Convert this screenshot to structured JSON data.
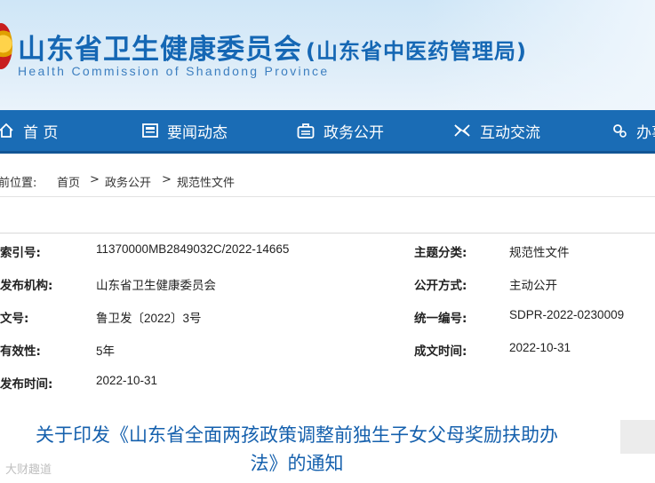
{
  "header": {
    "title": "山东省卫生健康委员会",
    "subtitle": "(山东省中医药管理局)",
    "english": "Health Commission of Shandong Province"
  },
  "nav": {
    "items": [
      {
        "label": "首 页",
        "icon": "home-icon"
      },
      {
        "label": "要闻动态",
        "icon": "news-icon"
      },
      {
        "label": "政务公开",
        "icon": "briefcase-icon"
      },
      {
        "label": "互动交流",
        "icon": "exchange-icon"
      },
      {
        "label": "办事",
        "icon": "gears-icon"
      }
    ],
    "colors": {
      "bar": "#1a6cb5",
      "text": "#ffffff"
    }
  },
  "breadcrumb": {
    "prefix": "前位置:",
    "items": [
      "首页",
      "政务公开",
      "规范性文件"
    ],
    "separator": ">"
  },
  "info": {
    "left": [
      {
        "key": "索引号:",
        "value": "11370000MB2849032C/2022-14665"
      },
      {
        "key": "发布机构:",
        "value": "山东省卫生健康委员会"
      },
      {
        "key": "文号:",
        "value": "鲁卫发〔2022〕3号"
      },
      {
        "key": "有效性:",
        "value": "5年"
      },
      {
        "key": "发布时间:",
        "value": "2022-10-31"
      }
    ],
    "right": [
      {
        "key": "主题分类:",
        "value": "规范性文件"
      },
      {
        "key": "公开方式:",
        "value": "主动公开"
      },
      {
        "key": "统一编号:",
        "value": "SDPR-2022-0230009"
      },
      {
        "key": "成文时间:",
        "value": "2022-10-31"
      }
    ]
  },
  "document": {
    "title_line1": "关于印发《山东省全面两孩政策调整前独生子女父母奖励扶助办",
    "title_line2": "法》的通知",
    "title_color": "#1560ad"
  },
  "watermark": "大财趣道"
}
